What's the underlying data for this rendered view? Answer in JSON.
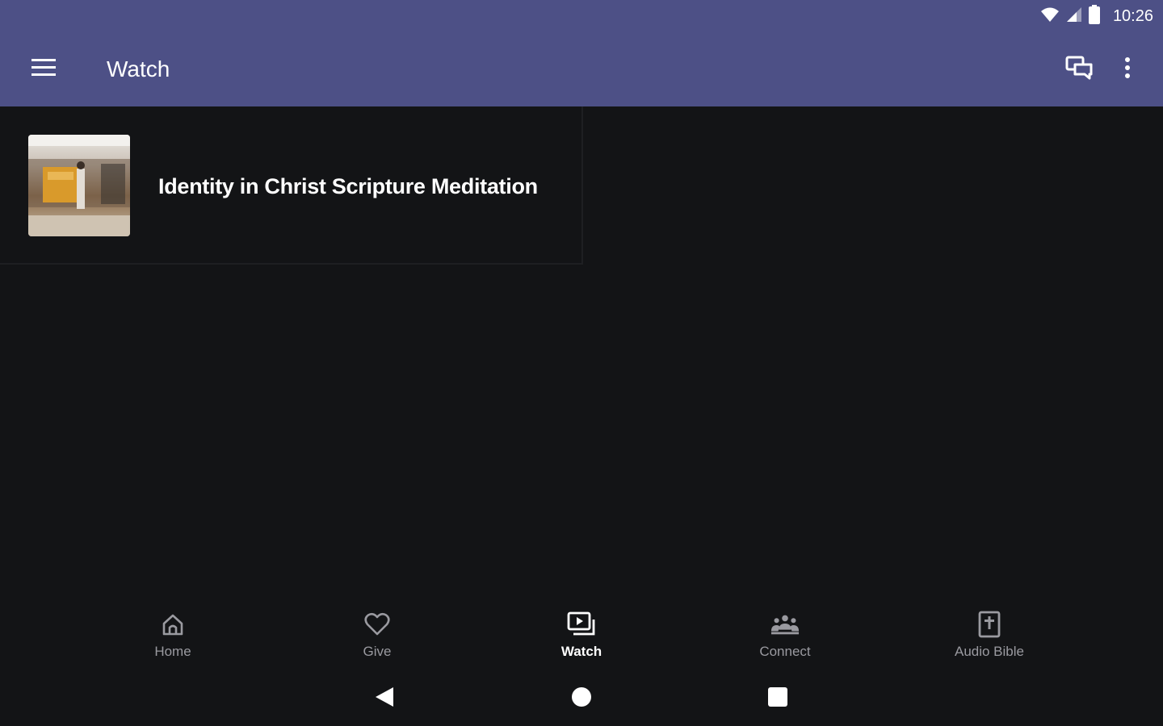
{
  "status_bar": {
    "time": "10:26",
    "icons": [
      "wifi-icon",
      "cell-signal-icon",
      "battery-icon"
    ]
  },
  "app_bar": {
    "title": "Watch",
    "menu_icon": "hamburger-menu-icon",
    "chat_icon": "chat-icon",
    "more_icon": "more-vert-icon",
    "background": "#4d5086"
  },
  "content": {
    "items": [
      {
        "title": "Identity in Christ Scripture Meditation",
        "thumbnail_icon": "video-thumbnail"
      }
    ]
  },
  "bottom_nav": {
    "items": [
      {
        "label": "Home",
        "icon": "home-icon",
        "active": false
      },
      {
        "label": "Give",
        "icon": "heart-icon",
        "active": false
      },
      {
        "label": "Watch",
        "icon": "video-library-icon",
        "active": true
      },
      {
        "label": "Connect",
        "icon": "group-icon",
        "active": false
      },
      {
        "label": "Audio Bible",
        "icon": "bible-icon",
        "active": false
      }
    ]
  },
  "system_nav": {
    "buttons": [
      "back-icon",
      "home-circle-icon",
      "recents-icon"
    ]
  },
  "colors": {
    "background": "#131416",
    "accent": "#4d5086",
    "inactive_nav": "#9a9aa0",
    "active_nav": "#ffffff"
  }
}
